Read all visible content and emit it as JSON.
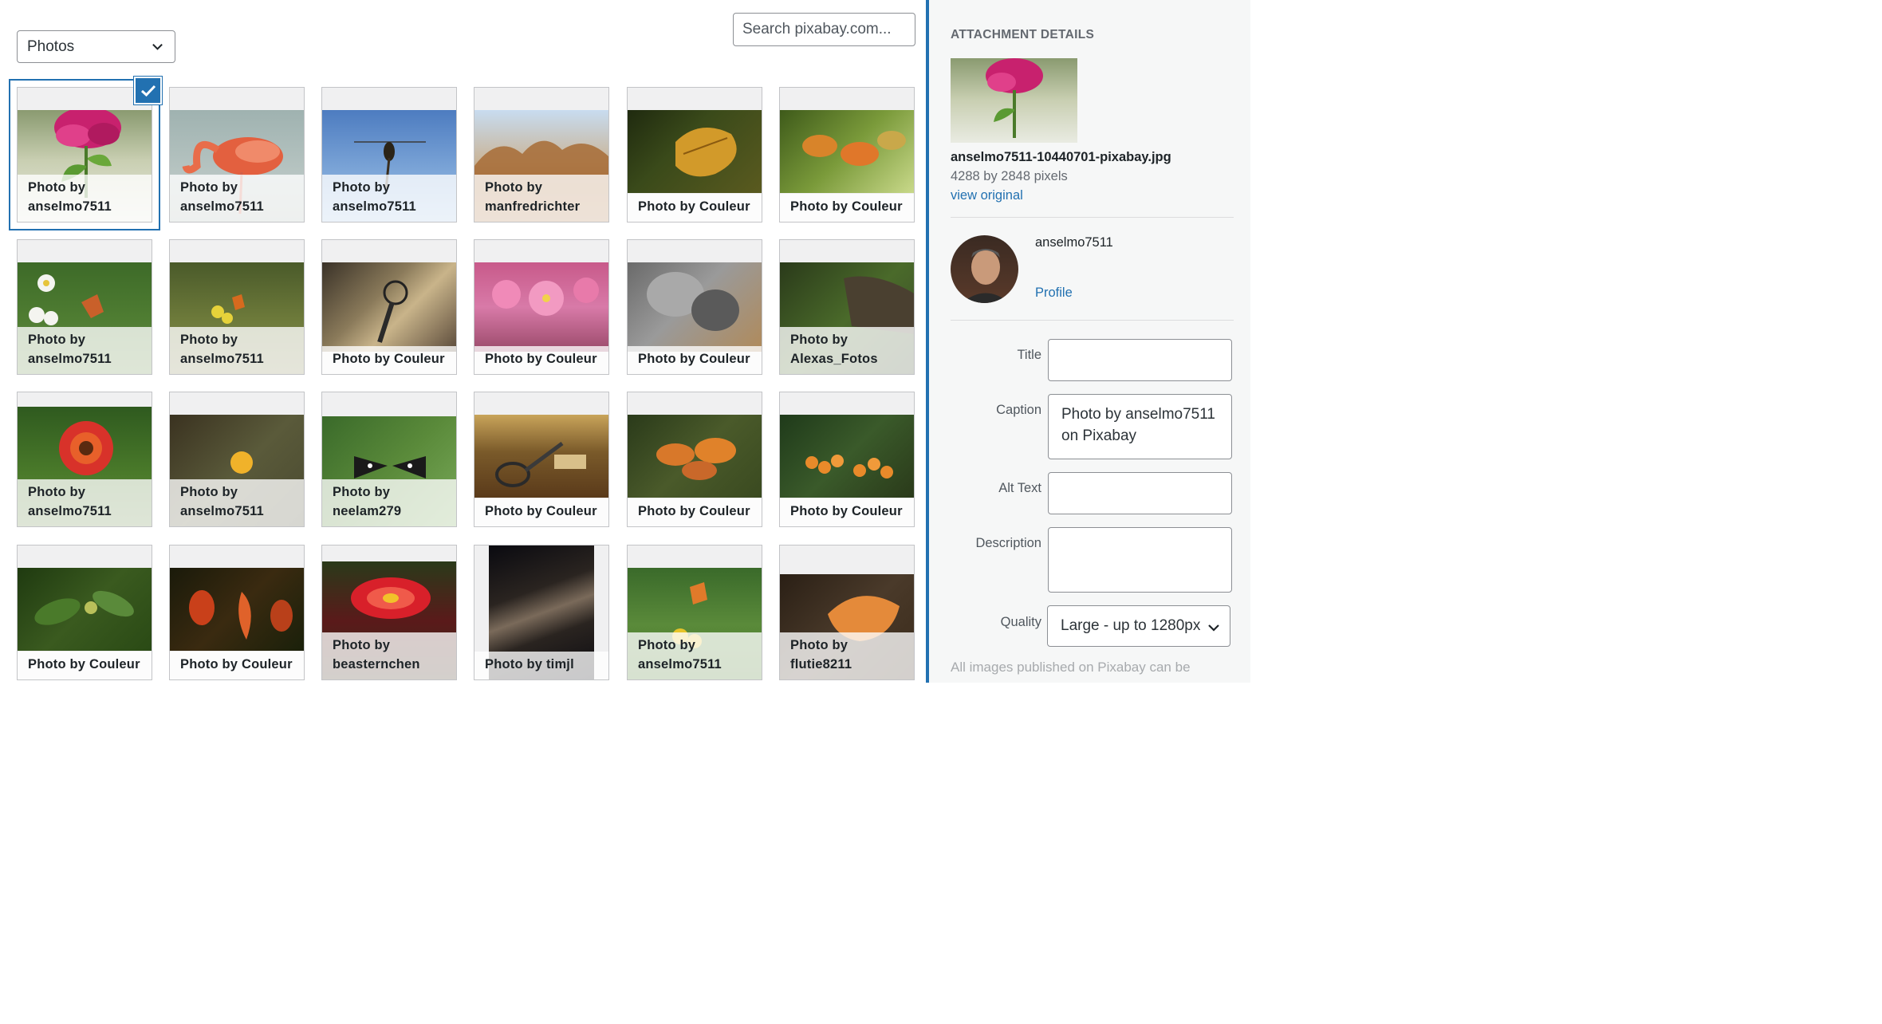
{
  "filter": {
    "selected": "Photos"
  },
  "search": {
    "placeholder": "Search pixabay.com..."
  },
  "tiles": [
    {
      "caption": "Photo by\nanselmo7511"
    },
    {
      "caption": "Photo by\nanselmo7511"
    },
    {
      "caption": "Photo by\nanselmo7511"
    },
    {
      "caption": "Photo by\nmanfredrichter"
    },
    {
      "caption": "Photo by Couleur"
    },
    {
      "caption": "Photo by Couleur"
    },
    {
      "caption": "Photo by\nanselmo7511"
    },
    {
      "caption": "Photo by\nanselmo7511"
    },
    {
      "caption": "Photo by Couleur"
    },
    {
      "caption": "Photo by Couleur"
    },
    {
      "caption": "Photo by Couleur"
    },
    {
      "caption": "Photo by\nAlexas_Fotos"
    },
    {
      "caption": "Photo by\nanselmo7511"
    },
    {
      "caption": "Photo by\nanselmo7511"
    },
    {
      "caption": "Photo by\nneelam279"
    },
    {
      "caption": "Photo by Couleur"
    },
    {
      "caption": "Photo by Couleur"
    },
    {
      "caption": "Photo by Couleur"
    },
    {
      "caption": "Photo by Couleur"
    },
    {
      "caption": "Photo by Couleur"
    },
    {
      "caption": "Photo by\nbeasternchen"
    },
    {
      "caption": "Photo by timjl"
    },
    {
      "caption": "Photo by\nanselmo7511"
    },
    {
      "caption": "Photo by\nflutie8211"
    }
  ],
  "details": {
    "heading": "ATTACHMENT DETAILS",
    "filename": "anselmo7511-10440701-pixabay.jpg",
    "dimensions": "4288 by 2848 pixels",
    "view_original": "view original",
    "username": "anselmo7511",
    "profile_link": "Profile",
    "fields": {
      "title_label": "Title",
      "title_value": "",
      "caption_label": "Caption",
      "caption_value": "Photo by anselmo7511 on Pixabay",
      "alt_label": "Alt Text",
      "alt_value": "",
      "description_label": "Description",
      "description_value": "",
      "quality_label": "Quality",
      "quality_value": "Large - up to 1280px"
    },
    "note": "All images published on Pixabay can be"
  },
  "accent_color": "#2271b1"
}
